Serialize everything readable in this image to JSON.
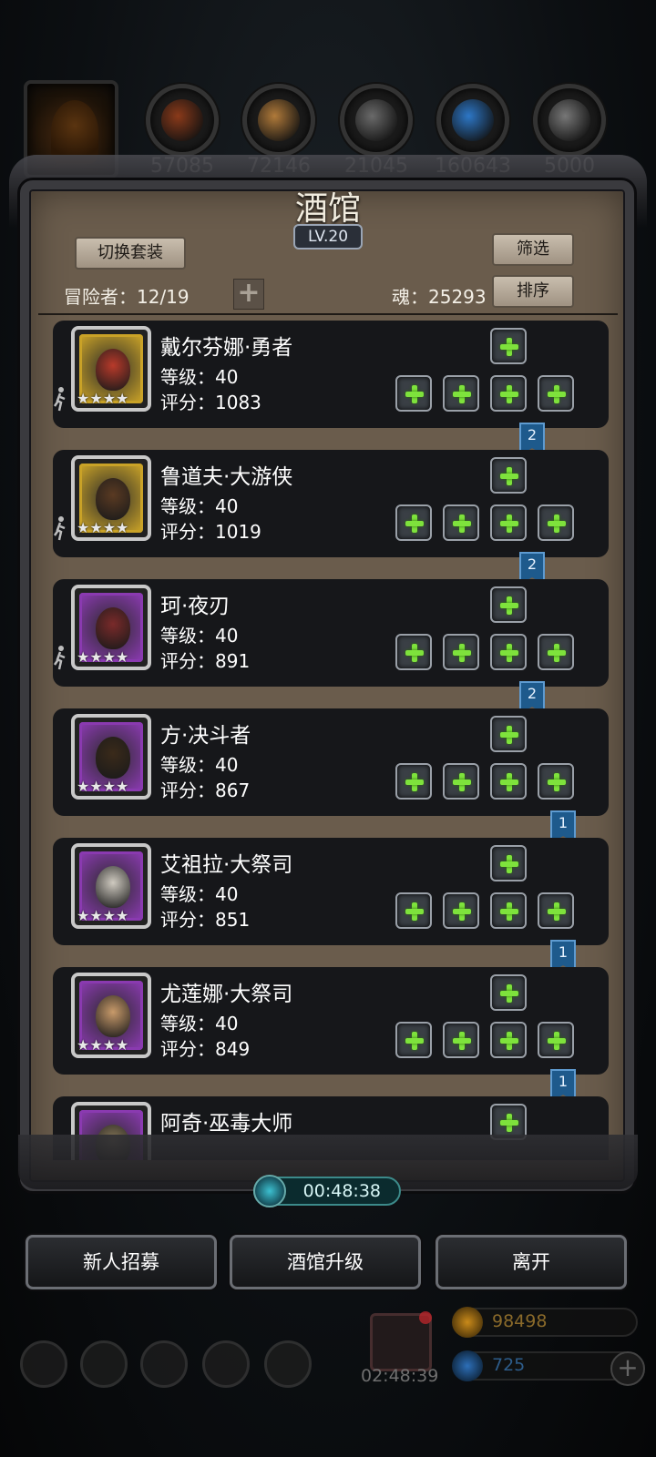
{
  "resources": [
    {
      "name": "leather-icon",
      "value": "57085",
      "color": "#8a3a1a"
    },
    {
      "name": "wood-icon",
      "value": "72146",
      "color": "#b07a3a"
    },
    {
      "name": "iron-icon",
      "value": "21045",
      "color": "#6a6a6a"
    },
    {
      "name": "crystal-icon",
      "value": "160643",
      "color": "#2d77c6"
    },
    {
      "name": "steel-icon",
      "value": "5000",
      "color": "#777777"
    }
  ],
  "panel": {
    "title": "酒馆",
    "level": "LV.20",
    "switch_outfit": "切换套装",
    "filter": "筛选",
    "sort": "排序",
    "adventurers_label": "冒险者：12/19",
    "soul_label": "魂：25293"
  },
  "heroes": [
    {
      "name": "戴尔芬娜·勇者",
      "level": "等级：40",
      "score": "评分：1083",
      "stars": "★★★★",
      "frame": "#c9a227",
      "tone": "#b83a2a",
      "ribbon": "2",
      "runner": true
    },
    {
      "name": "鲁道夫·大游侠",
      "level": "等级：40",
      "score": "评分：1019",
      "stars": "★★★★",
      "frame": "#c9a227",
      "tone": "#5a3a22",
      "ribbon": "2",
      "runner": true
    },
    {
      "name": "珂·夜刃",
      "level": "等级：40",
      "score": "评分：891",
      "stars": "★★★★",
      "frame": "#8a3ab0",
      "tone": "#7a2a2a",
      "ribbon": "2",
      "runner": true
    },
    {
      "name": "方·决斗者",
      "level": "等级：40",
      "score": "评分：867",
      "stars": "★★★★",
      "frame": "#8a3ab0",
      "tone": "#3a2a1a",
      "ribbon": "1",
      "runner": false
    },
    {
      "name": "艾祖拉·大祭司",
      "level": "等级：40",
      "score": "评分：851",
      "stars": "★★★★",
      "frame": "#8a3ab0",
      "tone": "#cfcac0",
      "ribbon": "1",
      "runner": false
    },
    {
      "name": "尤莲娜·大祭司",
      "level": "等级：40",
      "score": "评分：849",
      "stars": "★★★★",
      "frame": "#8a3ab0",
      "tone": "#c89a6a",
      "ribbon": "1",
      "runner": false
    },
    {
      "name": "阿奇·巫毒大师",
      "level": "",
      "score": "",
      "stars": "",
      "frame": "#8a3ab0",
      "tone": "#8a7a5a",
      "ribbon": "",
      "runner": false
    }
  ],
  "timer": "00:48:38",
  "buttons": {
    "recruit": "新人招募",
    "upgrade": "酒馆升级",
    "leave": "离开"
  },
  "hud": {
    "gift_timer": "02:48:39",
    "gold": "98498",
    "gems": "725",
    "gold_color": "#c98a1a",
    "gem_color": "#2d6fb8"
  }
}
